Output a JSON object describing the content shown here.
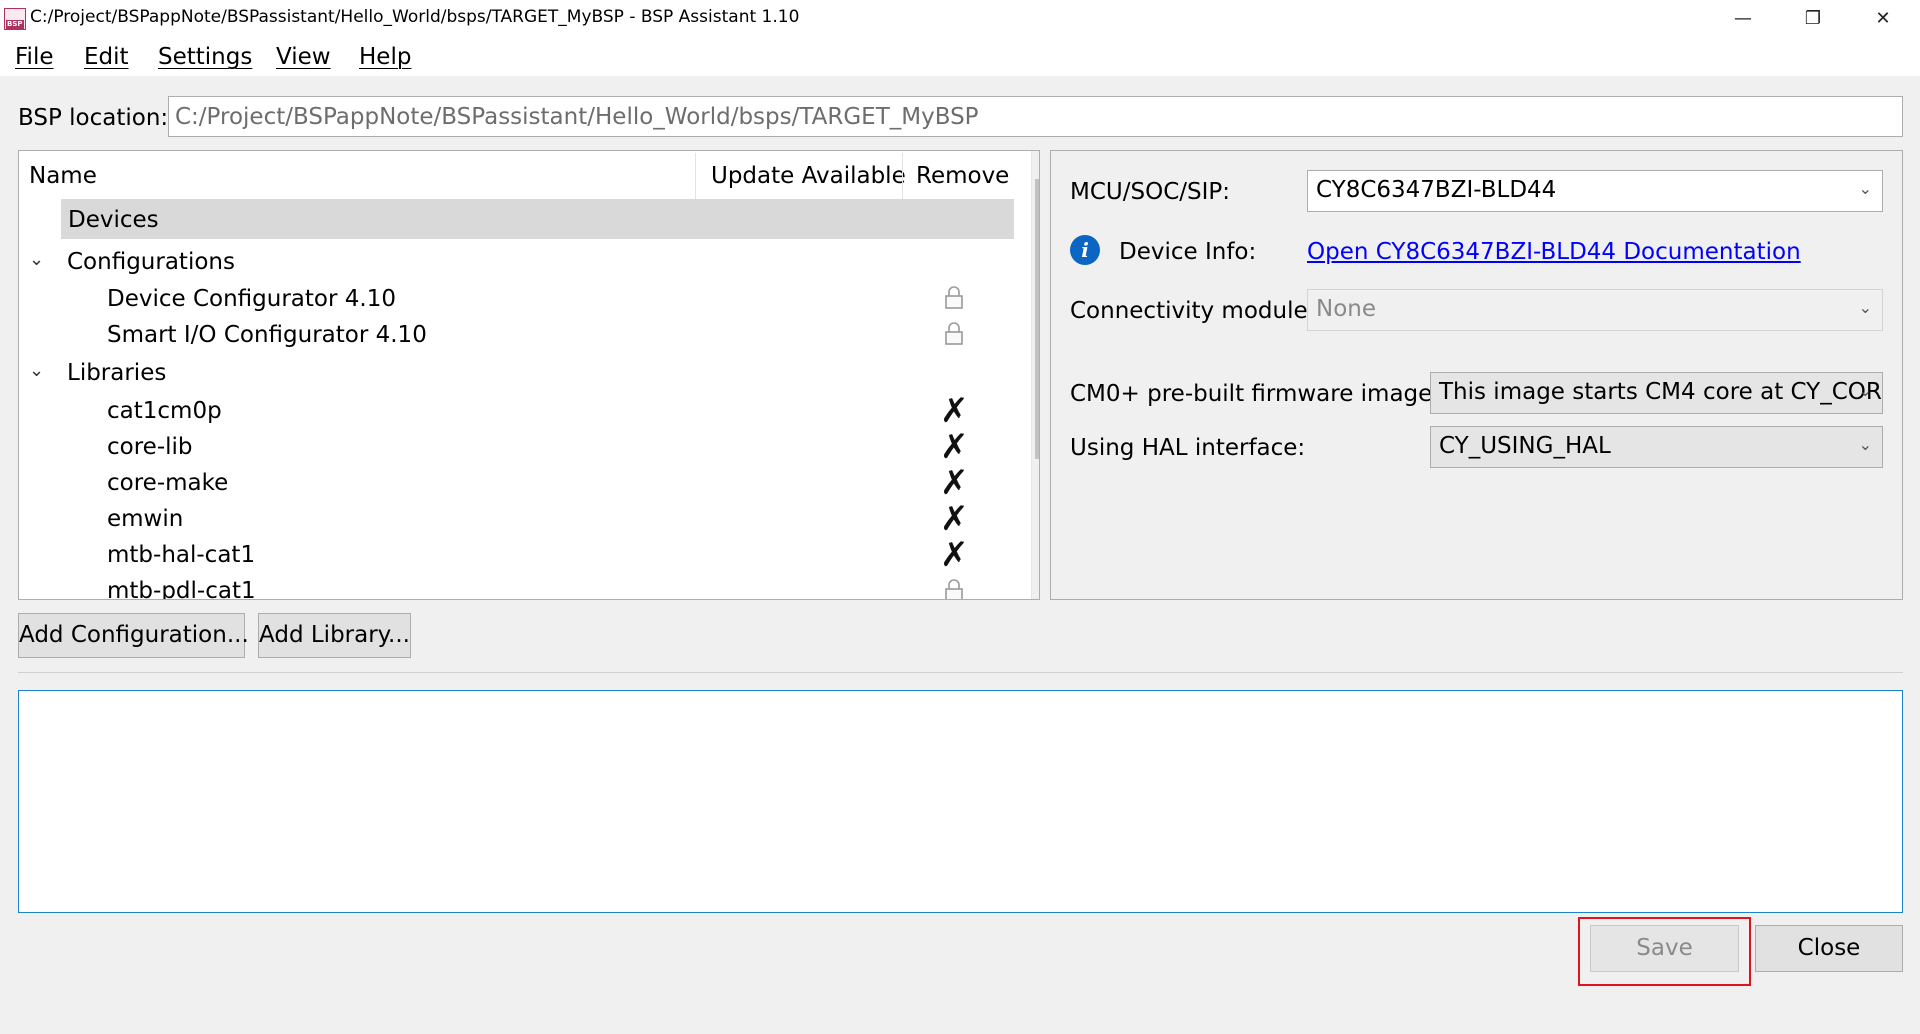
{
  "window": {
    "title": "C:/Project/BSPappNote/BSPassistant/Hello_World/bsps/TARGET_MyBSP - BSP Assistant 1.10",
    "app_icon_text": "BSP",
    "controls": {
      "minimize": "—",
      "restore": "❐",
      "close": "✕"
    }
  },
  "menu": {
    "items": [
      {
        "label": "File"
      },
      {
        "label": "Edit"
      },
      {
        "label": "Settings"
      },
      {
        "label": "View"
      },
      {
        "label": "Help"
      }
    ]
  },
  "bsp_location": {
    "label": "BSP location:",
    "value": "C:/Project/BSPappNote/BSPassistant/Hello_World/bsps/TARGET_MyBSP"
  },
  "tree": {
    "columns": {
      "name": "Name",
      "update": "Update Available",
      "remove": "Remove"
    },
    "devices": "Devices",
    "configurations": {
      "label": "Configurations",
      "items": [
        {
          "label": "Device Configurator 4.10",
          "remove_icon": "lock-icon"
        },
        {
          "label": "Smart I/O Configurator 4.10",
          "remove_icon": "lock-icon"
        }
      ]
    },
    "libraries": {
      "label": "Libraries",
      "items": [
        {
          "label": "cat1cm0p",
          "remove_icon": "remove-icon"
        },
        {
          "label": "core-lib",
          "remove_icon": "remove-icon"
        },
        {
          "label": "core-make",
          "remove_icon": "remove-icon"
        },
        {
          "label": "emwin",
          "remove_icon": "remove-icon"
        },
        {
          "label": "mtb-hal-cat1",
          "remove_icon": "remove-icon"
        },
        {
          "label": "mtb-pdl-cat1",
          "remove_icon": "lock-icon"
        }
      ]
    }
  },
  "device_panel": {
    "mcu_label": "MCU/SOC/SIP:",
    "mcu_value": "CY8C6347BZI-BLD44",
    "device_info_label": "Device Info:",
    "device_info_link": "Open CY8C6347BZI-BLD44 Documentation",
    "connectivity_label": "Connectivity module:",
    "connectivity_value": "None",
    "cm0_label": "CM0+ pre-built firmware image:",
    "cm0_value": "This image starts CM4 core at CY_COR",
    "hal_label": "Using HAL interface:",
    "hal_value": "CY_USING_HAL"
  },
  "buttons": {
    "add_configuration": "Add Configuration...",
    "add_library": "Add Library...",
    "save": "Save",
    "close": "Close"
  },
  "colors": {
    "highlight_border": "#e0131e",
    "link": "#0000ff",
    "log_border": "#1a84c7"
  }
}
